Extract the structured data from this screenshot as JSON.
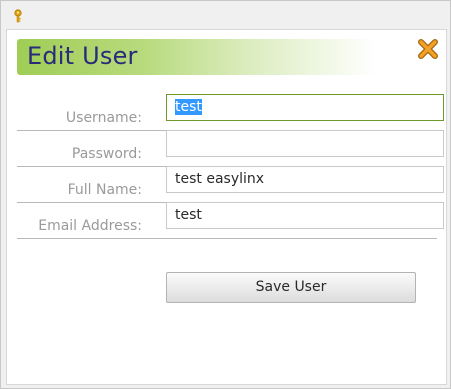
{
  "dialog": {
    "title": "Edit User",
    "icons": {
      "window": "key-icon",
      "close": "close-icon"
    },
    "colors": {
      "title": "#2a2a7a",
      "header_gradient_start": "#9fcd55",
      "focus_border": "#6e9a2c"
    }
  },
  "form": {
    "username": {
      "label": "Username:",
      "value": "test",
      "selected": true
    },
    "password": {
      "label": "Password:",
      "value": ""
    },
    "full_name": {
      "label": "Full Name:",
      "value": "test easylinx"
    },
    "email": {
      "label": "Email Address:",
      "value": "test"
    }
  },
  "actions": {
    "save_label": "Save User"
  }
}
